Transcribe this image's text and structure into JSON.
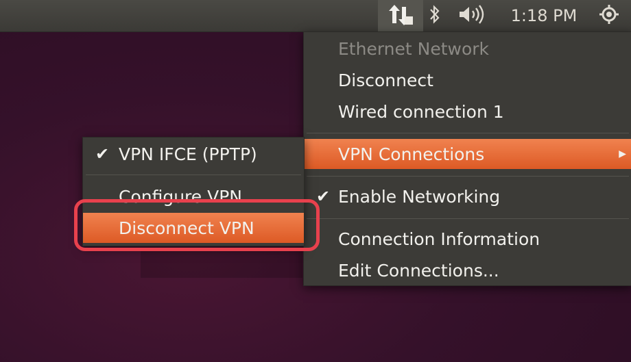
{
  "panel": {
    "clock": "1:18 PM",
    "icons": [
      "network-icon",
      "bluetooth-icon",
      "volume-icon",
      "power-icon"
    ]
  },
  "main_menu": {
    "section_title": "Ethernet Network",
    "disconnect": "Disconnect",
    "wired": "Wired connection 1",
    "vpn": "VPN Connections",
    "enable_networking": "Enable Networking",
    "enable_networking_checked": true,
    "connection_info": "Connection Information",
    "edit_connections": "Edit Connections..."
  },
  "vpn_submenu": {
    "vpn_item": "VPN IFCE (PPTP)",
    "vpn_item_checked": true,
    "configure": "Configure VPN...",
    "disconnect_vpn": "Disconnect VPN"
  },
  "colors": {
    "highlight": "#e8414d",
    "menu_bg": "#3c3b37",
    "selected_item": "#dd5a25"
  }
}
